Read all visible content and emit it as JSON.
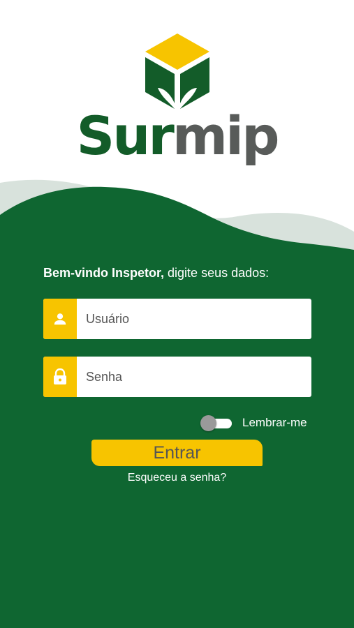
{
  "logo": {
    "name_part1": "Sur",
    "name_part2": "mip",
    "colors": {
      "green": "#135c29",
      "yellow": "#f7c400",
      "gray": "#585b59"
    }
  },
  "login": {
    "welcome_bold": "Bem-vindo Inspetor,",
    "welcome_rest": " digite seus dados:",
    "username": {
      "placeholder": "Usuário",
      "value": "",
      "icon": "user-icon"
    },
    "password": {
      "placeholder": "Senha",
      "value": "",
      "icon": "lock-icon"
    },
    "remember": {
      "label": "Lembrar-me",
      "checked": false
    },
    "submit_label": "Entrar",
    "forgot_label": "Esqueceu a senha?"
  },
  "colors": {
    "background_green": "#0f6631",
    "accent_yellow": "#f7c400",
    "wave_light": "#d8e2dc"
  }
}
